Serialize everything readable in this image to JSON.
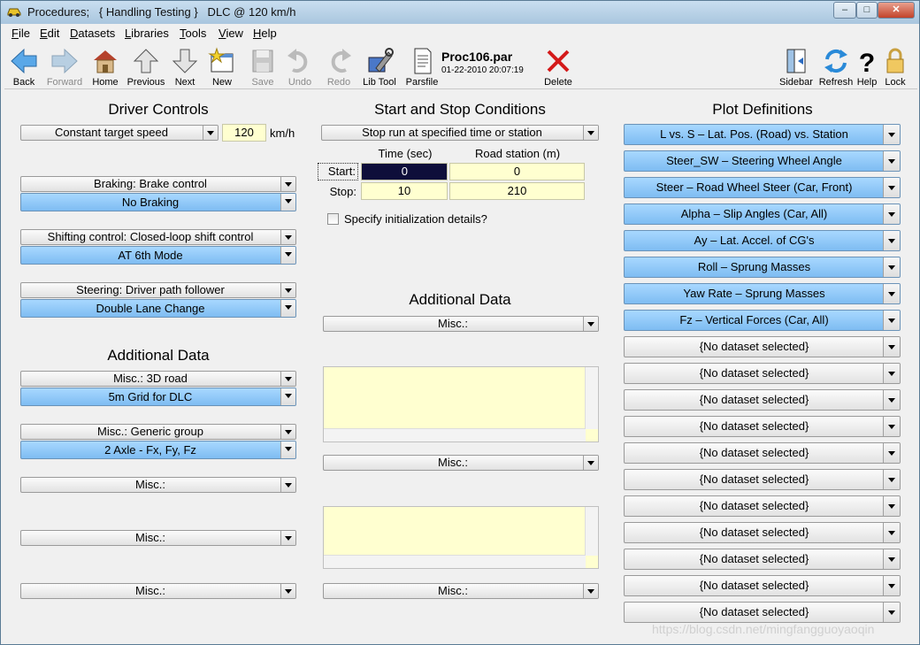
{
  "window": {
    "title": "Procedures;   { Handling Testing }   DLC @ 120 km/h",
    "controls": [
      "–",
      "□",
      "✕"
    ]
  },
  "menu": [
    "File",
    "Edit",
    "Datasets",
    "Libraries",
    "Tools",
    "View",
    "Help"
  ],
  "toolbar": {
    "back": "Back",
    "forward": "Forward",
    "home": "Home",
    "previous": "Previous",
    "next": "Next",
    "new": "New",
    "save": "Save",
    "undo": "Undo",
    "redo": "Redo",
    "libtool": "Lib Tool",
    "parsfile": "Parsfile",
    "delete": "Delete",
    "sidebar": "Sidebar",
    "refresh": "Refresh",
    "help": "Help",
    "lock": "Lock"
  },
  "file": {
    "name": "Proc106.par",
    "date": "01-22-2010 20:07:19"
  },
  "driver": {
    "title": "Driver Controls",
    "speed_mode": "Constant target speed",
    "speed_value": "120",
    "speed_unit": "km/h",
    "braking_label": "Braking: Brake control",
    "braking_value": "No Braking",
    "shifting_label": "Shifting control: Closed-loop shift control",
    "shifting_value": "AT 6th Mode",
    "steering_label": "Steering: Driver path follower",
    "steering_value": "Double Lane Change"
  },
  "left_additional": {
    "title": "Additional Data",
    "items": [
      {
        "label": "Misc.: 3D road",
        "value": "5m Grid for DLC"
      },
      {
        "label": "Misc.: Generic group",
        "value": "2 Axle - Fx, Fy, Fz"
      }
    ],
    "misc1": "Misc.:",
    "misc2": "Misc.:",
    "misc3": "Misc.:"
  },
  "startstop": {
    "title": "Start and Stop Conditions",
    "mode": "Stop run at specified time or station",
    "col_time": "Time (sec)",
    "col_station": "Road station (m)",
    "start_label": "Start:",
    "stop_label": "Stop:",
    "start_time": "0",
    "start_station": "0",
    "stop_time": "10",
    "stop_station": "210",
    "init_checkbox": "Specify initialization details?"
  },
  "middle_additional": {
    "title": "Additional Data",
    "misc_top": "Misc.:",
    "misc_mid": "Misc.:",
    "misc_bottom": "Misc.:"
  },
  "plots": {
    "title": "Plot Definitions",
    "items": [
      "L vs. S – Lat. Pos. (Road) vs. Station",
      "Steer_SW – Steering Wheel Angle",
      "Steer – Road Wheel Steer (Car, Front)",
      "Alpha – Slip Angles (Car, All)",
      "Ay – Lat. Accel. of CG's",
      "Roll – Sprung Masses",
      "Yaw Rate – Sprung Masses",
      "Fz – Vertical Forces (Car, All)",
      "{No dataset selected}",
      "{No dataset selected}",
      "{No dataset selected}",
      "{No dataset selected}",
      "{No dataset selected}",
      "{No dataset selected}",
      "{No dataset selected}",
      "{No dataset selected}",
      "{No dataset selected}",
      "{No dataset selected}",
      "{No dataset selected}"
    ],
    "active_count": 8
  },
  "watermark": "https://blog.csdn.net/mingfangguoyaoqin"
}
